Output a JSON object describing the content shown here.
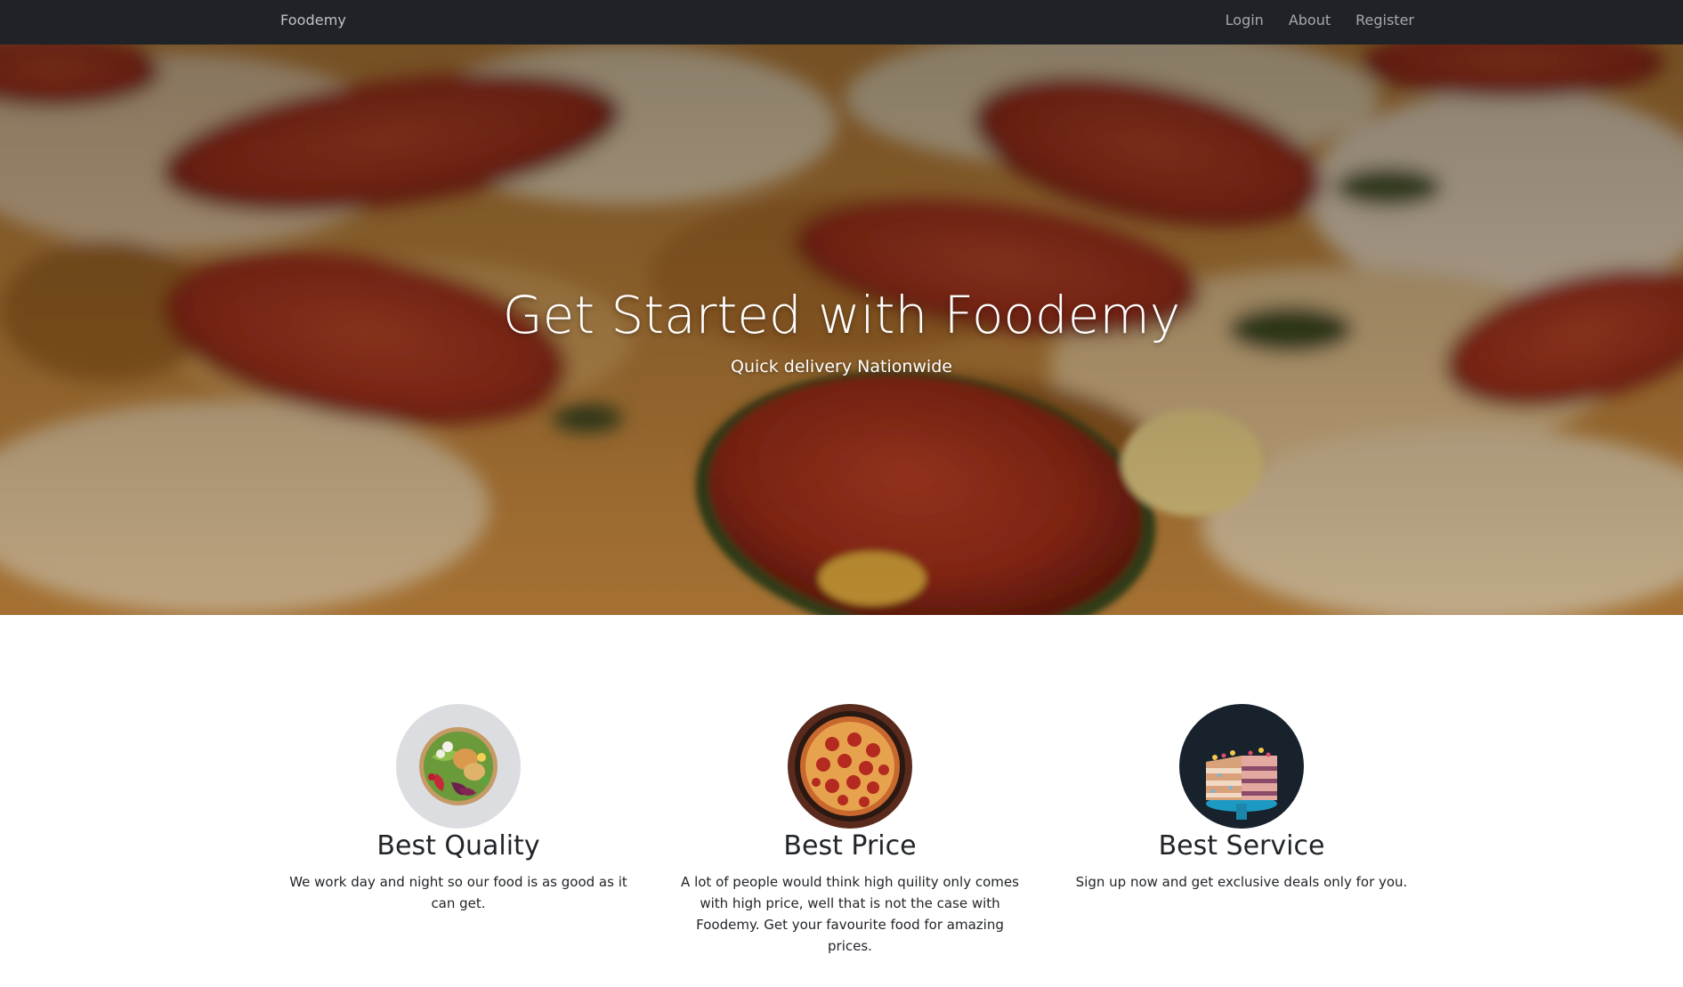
{
  "navbar": {
    "brand": "Foodemy",
    "links": [
      {
        "label": "Login"
      },
      {
        "label": "About"
      },
      {
        "label": "Register"
      }
    ]
  },
  "hero": {
    "title": "Get Started with Foodemy",
    "subtitle": "Quick delivery Nationwide"
  },
  "features": [
    {
      "image": "salad-bowl-image",
      "title": "Best Quality",
      "text": "We work day and night so our food is as good as it can get."
    },
    {
      "image": "pepperoni-pizza-image",
      "title": "Best Price",
      "text": "A lot of people would think high quility only comes with high price, well that is not the case with Foodemy. Get your favourite food for amazing prices."
    },
    {
      "image": "layer-cake-image",
      "title": "Best Service",
      "text": "Sign up now and get exclusive deals only for you."
    }
  ],
  "colors": {
    "navbar_bg": "#1f2227",
    "nav_text": "#9a9ca0",
    "hero_overlay": "#000000",
    "body_text": "#212529"
  }
}
